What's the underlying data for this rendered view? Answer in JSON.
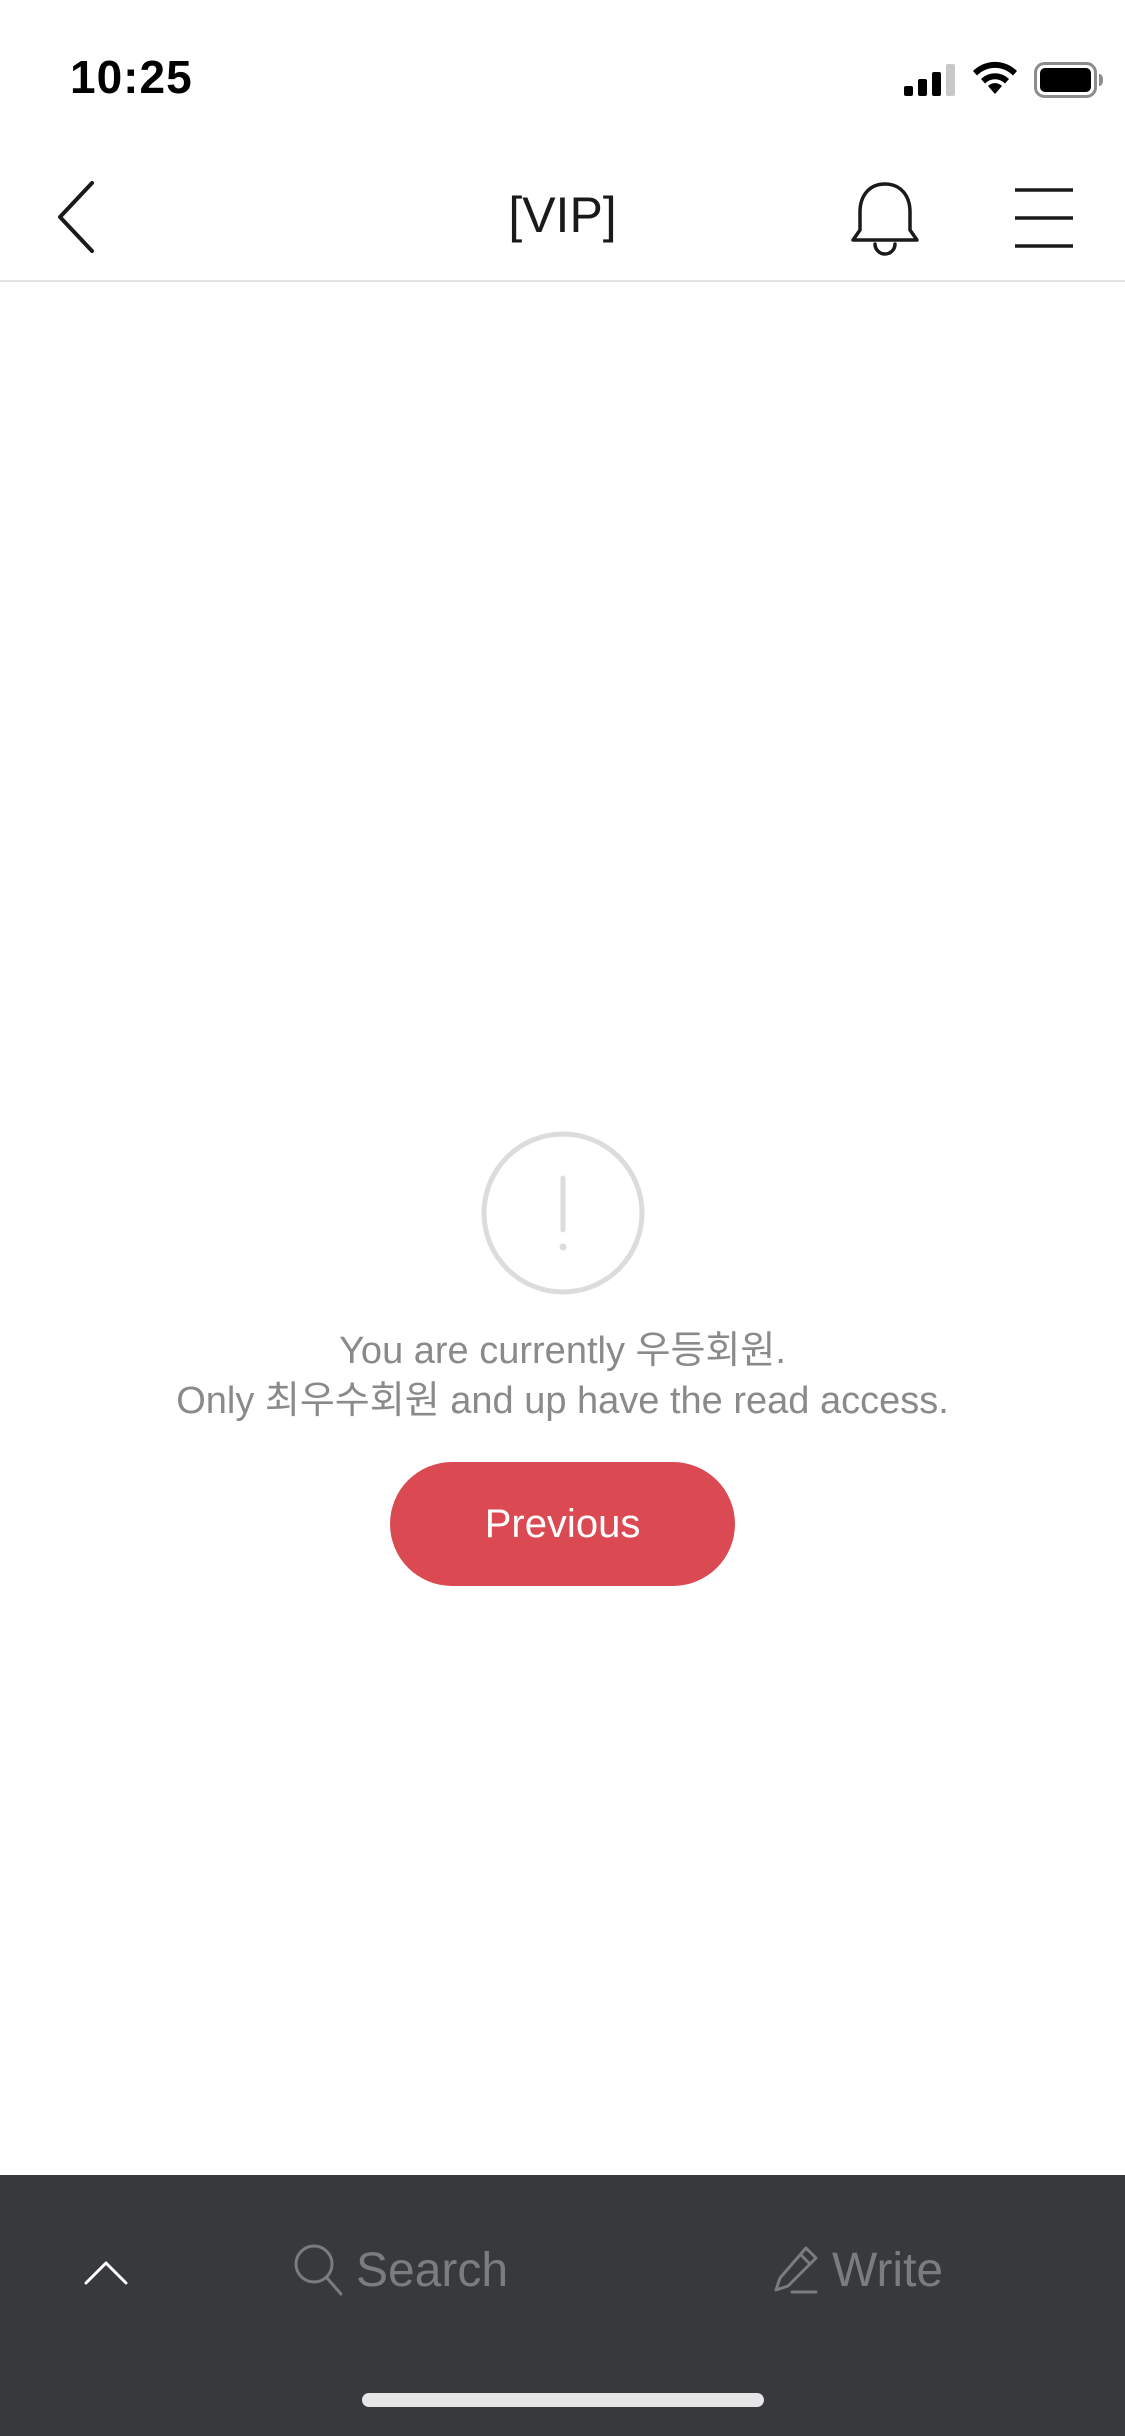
{
  "status_bar": {
    "time": "10:25"
  },
  "header": {
    "title": "[VIP]"
  },
  "notice": {
    "line1": "You are currently 우등회원.",
    "line2": "Only 최우수회원 and up have the read access.",
    "previous_label": "Previous"
  },
  "bottom_bar": {
    "search_label": "Search",
    "write_label": "Write"
  },
  "colors": {
    "accent": "#db4a52",
    "bottom_bar_bg": "#38393d",
    "muted_text": "#8a8a8a"
  },
  "icons": {
    "back": "chevron-left-icon",
    "notifications": "bell-icon",
    "menu": "hamburger-menu-icon",
    "warning": "exclamation-circle-icon",
    "scroll_top": "chevron-up-icon",
    "search": "magnifier-icon",
    "write": "pencil-icon"
  }
}
